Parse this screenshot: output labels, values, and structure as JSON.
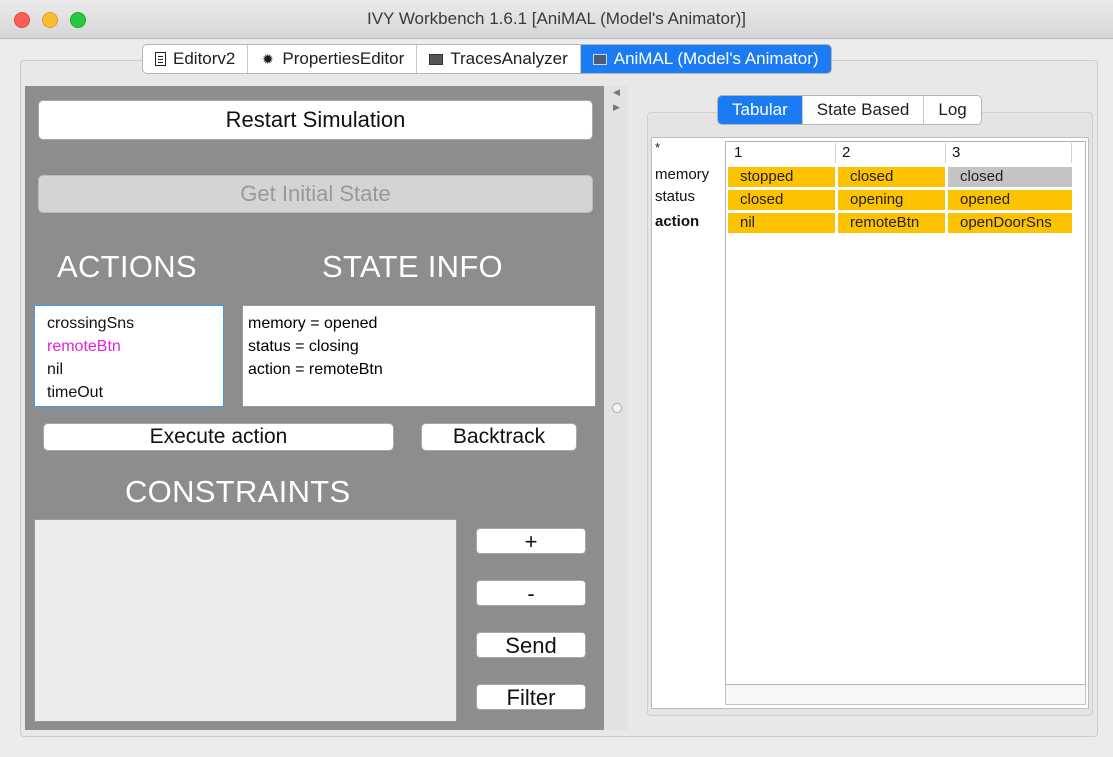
{
  "window": {
    "title": "IVY Workbench 1.6.1 [AniMAL (Model's Animator)]"
  },
  "tabs": [
    {
      "label": "Editorv2",
      "icon": "document-icon"
    },
    {
      "label": "PropertiesEditor",
      "icon": "bug-icon"
    },
    {
      "label": "TracesAnalyzer",
      "icon": "terminal-icon"
    },
    {
      "label": "AniMAL (Model's Animator)",
      "icon": "terminal-icon",
      "active": true
    }
  ],
  "left": {
    "restart_label": "Restart Simulation",
    "initial_state_label": "Get Initial State",
    "actions_title": "ACTIONS",
    "state_info_title": "STATE INFO",
    "actions": [
      {
        "label": "crossingSns",
        "selected": false
      },
      {
        "label": "remoteBtn",
        "selected": true
      },
      {
        "label": "nil",
        "selected": false
      },
      {
        "label": "timeOut",
        "selected": false
      }
    ],
    "state_info": [
      "memory = opened",
      "status = closing",
      "action = remoteBtn"
    ],
    "execute_label": "Execute action",
    "backtrack_label": "Backtrack",
    "constraints_title": "CONSTRAINTS",
    "plus_label": "+",
    "minus_label": "-",
    "send_label": "Send",
    "filter_label": "Filter"
  },
  "right": {
    "view_tabs": [
      {
        "label": "Tabular",
        "active": true
      },
      {
        "label": "State Based",
        "active": false
      },
      {
        "label": "Log",
        "active": false
      }
    ],
    "corner": "*",
    "row_labels": [
      "memory",
      "status",
      "action"
    ],
    "columns": [
      "1",
      "2",
      "3"
    ],
    "rows": [
      [
        "stopped",
        "closed",
        "closed"
      ],
      [
        "closed",
        "opening",
        "opened"
      ],
      [
        "nil",
        "remoteBtn",
        "openDoorSns"
      ]
    ],
    "colors": {
      "highlight": "#fdc300",
      "unchanged": "#c4c4c4",
      "active_tab": "#1b7bf2"
    }
  }
}
